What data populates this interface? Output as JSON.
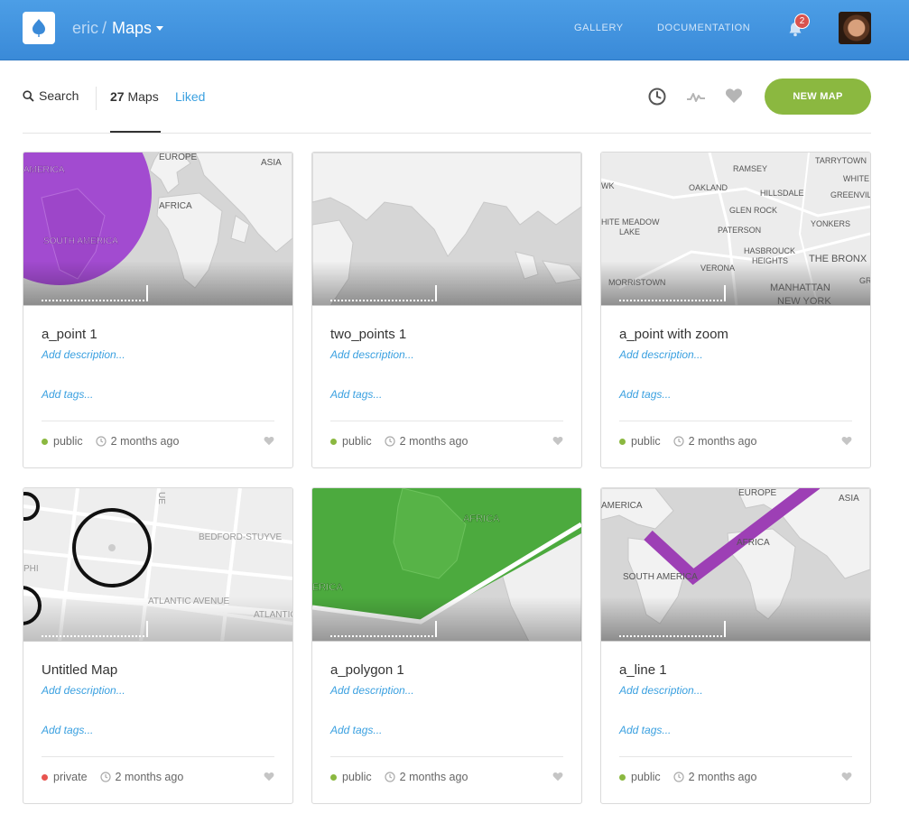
{
  "header": {
    "user": "eric",
    "separator": "/",
    "section": "Maps",
    "nav": [
      "GALLERY",
      "DOCUMENTATION"
    ],
    "notifications": "2",
    "icons": [
      "logo-icon",
      "caret-down-icon",
      "bell-icon",
      "avatar"
    ],
    "colors": {
      "bar": "#4c9ee6",
      "badge": "#d9534f"
    }
  },
  "filters": {
    "search": "Search",
    "count": "27",
    "count_label": "Maps",
    "liked": "Liked",
    "new_map": "NEW MAP",
    "icons": [
      "search-icon",
      "clock-icon",
      "activity-icon",
      "heart-icon"
    ],
    "colors": {
      "liked": "#3aa0e0",
      "new_map": "#8bb840"
    }
  },
  "cards": [
    {
      "title": "a_point 1",
      "desc": "Add description...",
      "tags": "Add tags...",
      "privacy": "public",
      "privacy_color": "#8bb840",
      "updated": "2 months ago",
      "map_labels": [
        "AMERICA",
        "EUROPE",
        "ASIA",
        "AFRICA",
        "SOUTH AMERICA"
      ]
    },
    {
      "title": "two_points 1",
      "desc": "Add description...",
      "tags": "Add tags...",
      "privacy": "public",
      "privacy_color": "#8bb840",
      "updated": "2 months ago",
      "map_labels": []
    },
    {
      "title": "a_point with zoom",
      "desc": "Add description...",
      "tags": "Add tags...",
      "privacy": "public",
      "privacy_color": "#8bb840",
      "updated": "2 months ago",
      "map_labels": [
        "TARRYTOWN",
        "RAMSEY",
        "WHITE",
        "WK",
        "OAKLAND",
        "HILLSDALE",
        "GREENVIL",
        "GLEN ROCK",
        "HITE MEADOW",
        "LAKE",
        "PATERSON",
        "YONKERS",
        "HASBROUCK",
        "HEIGHTS",
        "THE BRONX",
        "VERONA",
        "MORRISTOWN",
        "MANHATTAN",
        "GR",
        "NEW YORK"
      ]
    },
    {
      "title": "Untitled Map",
      "desc": "Add description...",
      "tags": "Add tags...",
      "privacy": "private",
      "privacy_color": "#e8544f",
      "updated": "2 months ago",
      "map_labels": [
        "UE",
        "BEDFORD-STUYVE",
        "PHI",
        "ATLANTIC AVENUE",
        "ATLANTIC"
      ]
    },
    {
      "title": "a_polygon 1",
      "desc": "Add description...",
      "tags": "Add tags...",
      "privacy": "public",
      "privacy_color": "#8bb840",
      "updated": "2 months ago",
      "map_labels": [
        "AFRICA",
        "ERICA"
      ]
    },
    {
      "title": "a_line 1",
      "desc": "Add description...",
      "tags": "Add tags...",
      "privacy": "public",
      "privacy_color": "#8bb840",
      "updated": "2 months ago",
      "map_labels": [
        "AMERICA",
        "EUROPE",
        "ASIA",
        "AFRICA",
        "SOUTH AMERICA"
      ]
    }
  ]
}
